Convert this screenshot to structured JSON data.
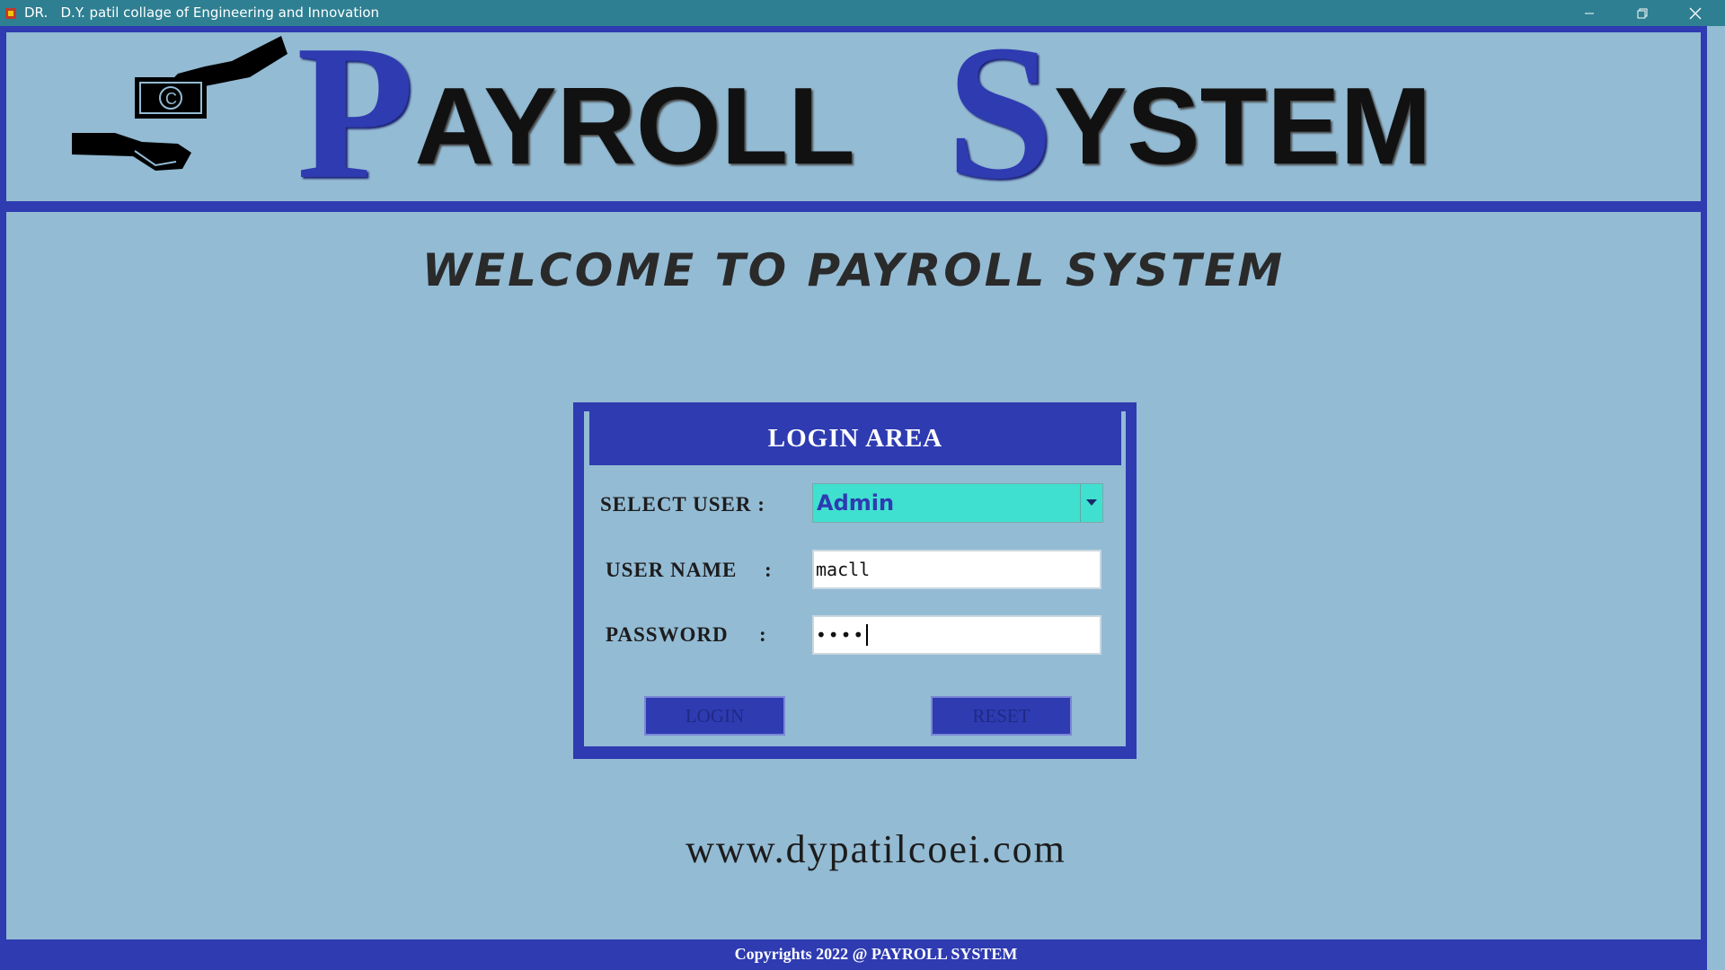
{
  "window": {
    "title": "DR.   D.Y. patil collage of Engineering and Innovation",
    "minimize_icon": "minimize-icon",
    "maximize_icon": "restore-icon",
    "close_icon": "close-icon"
  },
  "header": {
    "logo_icon": "money-hands-icon",
    "logo_first_big": "P",
    "logo_first_rest": "AYROLL",
    "logo_second_big": "S",
    "logo_second_rest": "YSTEM"
  },
  "welcome": "WELCOME TO PAYROLL SYSTEM",
  "login": {
    "title": "LOGIN AREA",
    "select_user_label": "SELECT USER :",
    "select_user_value": "Admin",
    "username_label": "USER NAME",
    "username_value": "macll",
    "password_label": "PASSWORD",
    "password_value": "••••",
    "colon": ":",
    "login_button": "LOGIN",
    "reset_button": "RESET"
  },
  "website": "www.dypatilcoei.com",
  "footer": "Copyrights 2022 @ PAYROLL SYSTEM",
  "colors": {
    "background": "#93bbd4",
    "accent": "#2e3bb1",
    "titlebar": "#2e7f91",
    "select": "#40e0d0"
  }
}
